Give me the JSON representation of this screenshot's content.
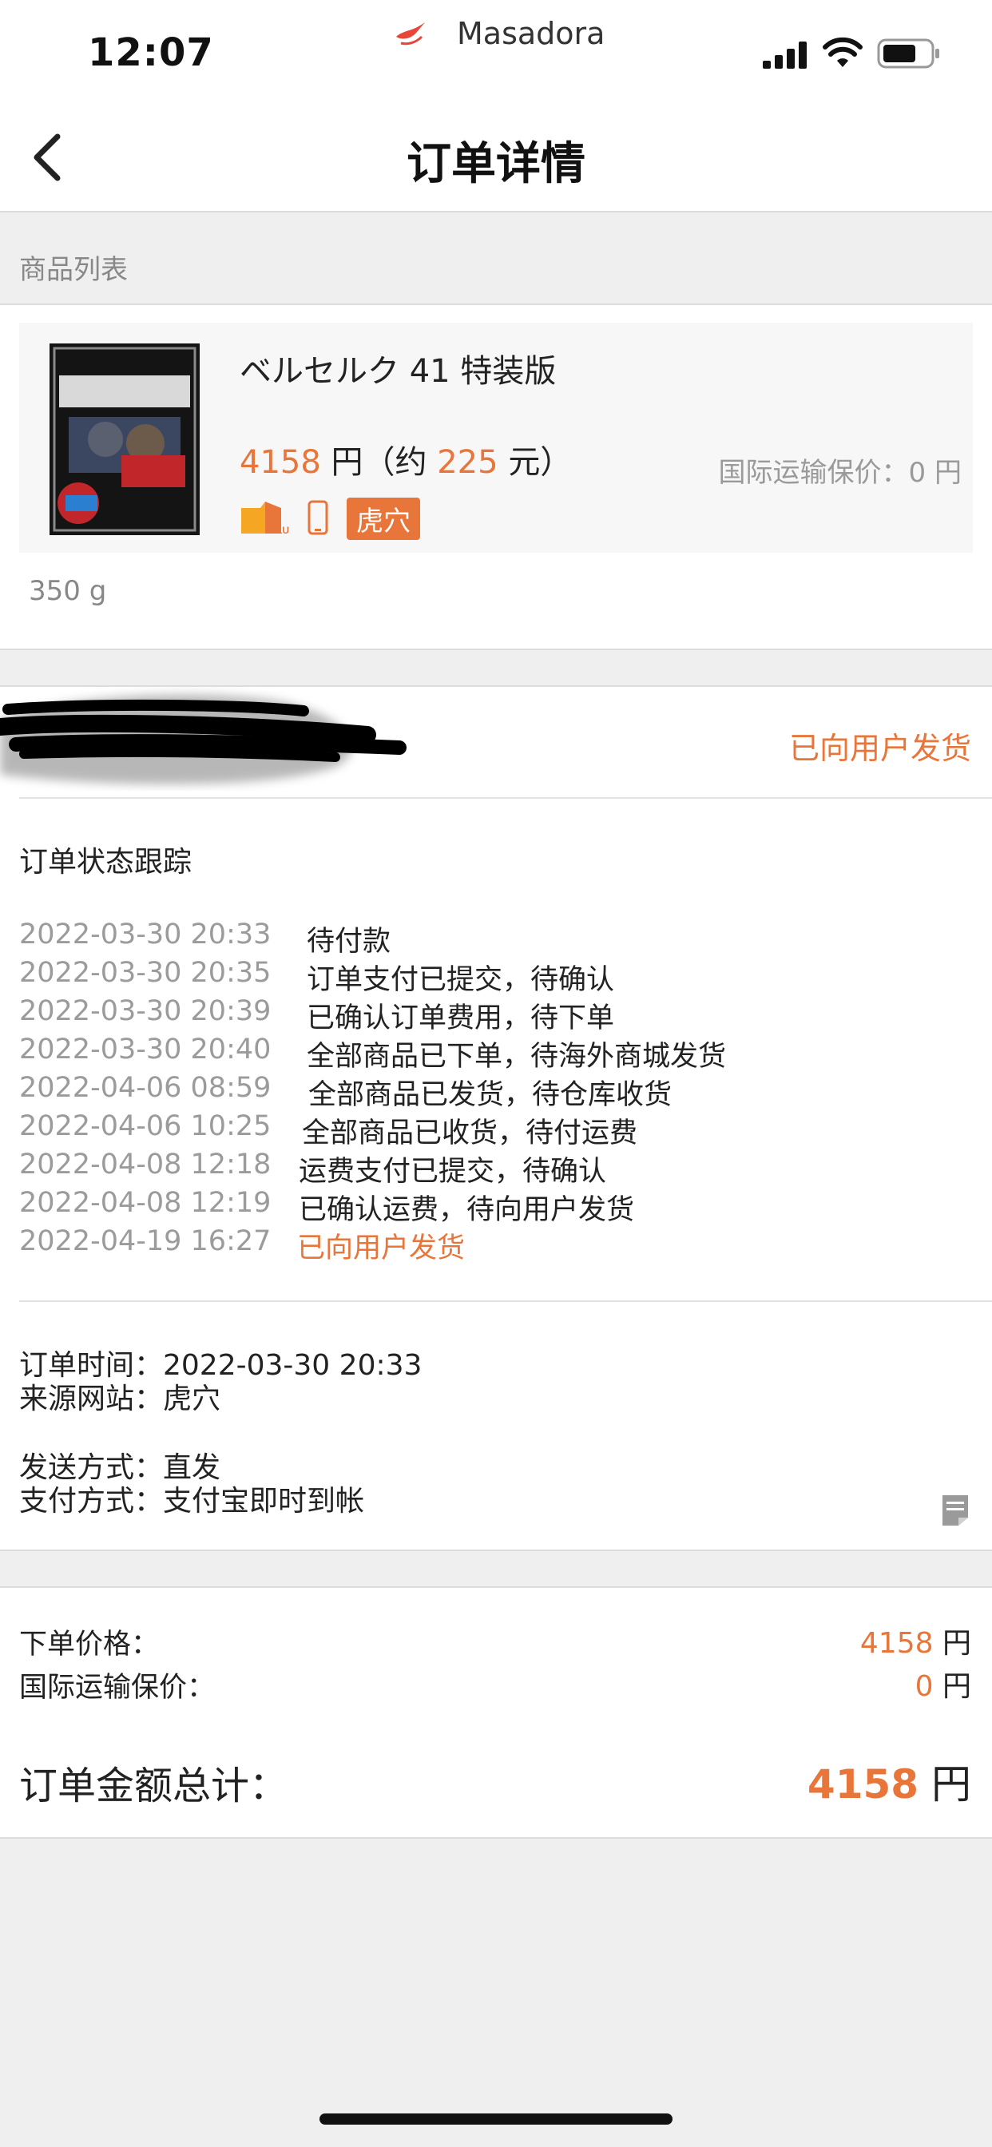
{
  "status_bar": {
    "time": "12:07",
    "carrier": "Masadora"
  },
  "nav": {
    "title": "订单详情"
  },
  "product_list": {
    "section_label": "商品列表",
    "product": {
      "name": "ベルセルク 41 特装版",
      "price_yen": "4158",
      "price_unit": "円（约",
      "price_cny": "225",
      "price_cny_unit": "元）",
      "shipping_insurance": "国际运输保价：0 円",
      "source_badge": "虎穴",
      "weight": "350 g"
    }
  },
  "order_status": {
    "current_status": "已向用户发货",
    "tracking_title": "订单状态跟踪",
    "timeline": [
      {
        "date": "2022-03-30 20:33",
        "text": "待付款"
      },
      {
        "date": "2022-03-30 20:35",
        "text": "订单支付已提交，待确认"
      },
      {
        "date": "2022-03-30 20:39",
        "text": "已确认订单费用，待下单"
      },
      {
        "date": "2022-03-30 20:40",
        "text": "全部商品已下单，待海外商城发货"
      },
      {
        "date": "2022-04-06 08:59",
        "text": "全部商品已发货，待仓库收货"
      },
      {
        "date": "2022-04-06 10:25",
        "text": "全部商品已收货，待付运费"
      },
      {
        "date": "2022-04-08 12:18",
        "text": "运费支付已提交，待确认"
      },
      {
        "date": "2022-04-08 12:19",
        "text": "已确认运费，待向用户发货"
      },
      {
        "date": "2022-04-19 16:27",
        "text": "已向用户发货"
      }
    ],
    "info": {
      "order_time": "订单时间：2022-03-30 20:33",
      "source_site": "来源网站：虎穴",
      "delivery_method": "发送方式：直发",
      "payment_method": "支付方式：支付宝即时到帐"
    }
  },
  "pricing": {
    "order_price_label": "下单价格：",
    "order_price_value": "4158",
    "insurance_label": "国际运输保价：",
    "insurance_value": "0",
    "currency": "円",
    "total_label": "订单金额总计：",
    "total_value": "4158"
  },
  "colors": {
    "accent": "#e8763a",
    "background": "#efefef"
  }
}
